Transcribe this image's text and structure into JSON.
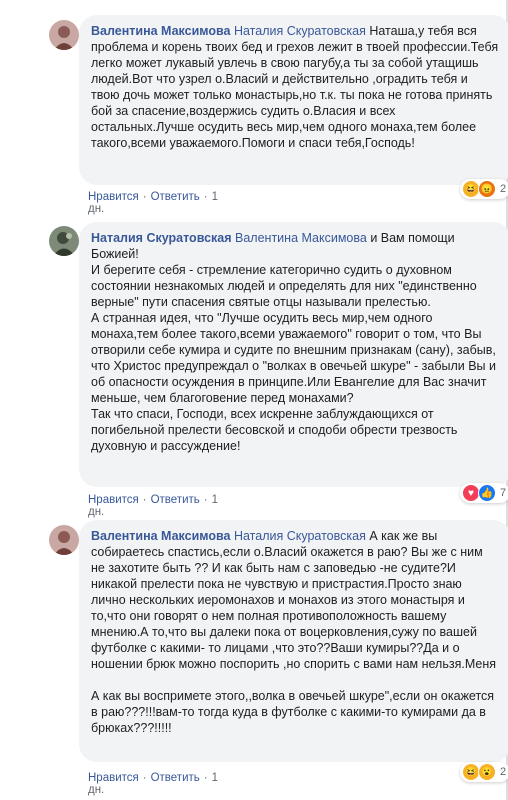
{
  "actions": {
    "like": "Нравится",
    "reply": "Ответить",
    "sep": "·"
  },
  "comments": [
    {
      "author": "Валентина Максимова",
      "mention": "Наталия Скуратовская",
      "text": " Наташа,у тебя вся проблема и корень твоих бед и грехов лежит в твоей профессии.Тебя легко может лукавый увлечь в свою пагубу,а ты за собой утащишь людей.Вот что узрел о.Власий и действительно ,оградить тебя и твою дочь может только монастырь,но т.к. ты пока не готова принять бой за спасение,воздержись судить о.Власия и всех остальных.Лучше осудить весь мир,чем одного монаха,тем более такого,всеми уважаемого.Помоги и спаси тебя,Господь!",
      "time": "1 дн.",
      "reaction_count": "2",
      "reactions": [
        "haha-icon",
        "angry-icon"
      ]
    },
    {
      "author": "Наталия Скуратовская",
      "mention": "Валентина Максимова",
      "text": " и Вам помощи Божией!\nИ берегите себя - стремление категорично судить о духовном состоянии незнакомых людей и определять для них \"единственно верные\" пути спасения святые отцы называли прелестью.\nА странная идея, что \"Лучше осудить весь мир,чем одного монаха,тем более такого,всеми уважаемого\" говорит о том, что Вы отворили себе кумира и судите по внешним признакам (сану), забыв, что Христос предупреждал о \"волках в овечьей шкуре\" - забыли Вы и об опасности осуждения в принципе.Или Евангелие для Вас значит меньше, чем благоговение перед монахами?\nТак что спаси, Господи, всех искренне заблуждающихся от погибельной прелести бесовской и сподоби обрести трезвость духовную и рассуждение!",
      "time": "1 дн.",
      "reaction_count": "7",
      "reactions": [
        "love-icon",
        "like-icon"
      ]
    },
    {
      "author": "Валентина Максимова",
      "mention": "Наталия Скуратовская",
      "text": " А как же вы собираетесь спастись,если о.Власий окажется в раю? Вы же с ним не захотите быть ?? И как быть нам с заповедью -не судите?И никакой прелести пока не чувствую и пристрастия.Просто знаю лично нескольких иеромонахов и монахов из этого монастыря и то,что они говорят о нем полная противоположность вашему мнению.А то,что вы далеки пока от воцерковления,сужу по вашей футболке с какими- то лицами ,что это??Ваши кумиры??Да и о ношении брюк можно поспорить ,но спорить с вами нам нельзя.Меня\n\nА как вы воспримете этого,,волка в овечьей шкуре\",если он окажется в раю???!!!вам-то тогда куда в футболке с какими-то кумирами да в брюках???!!!!!",
      "time": "1 дн.",
      "reaction_count": "2",
      "reactions": [
        "haha-icon",
        "wow-icon"
      ]
    }
  ],
  "colors": {
    "link": "#385898",
    "bubble": "#f2f3f5",
    "meta": "#606770"
  }
}
